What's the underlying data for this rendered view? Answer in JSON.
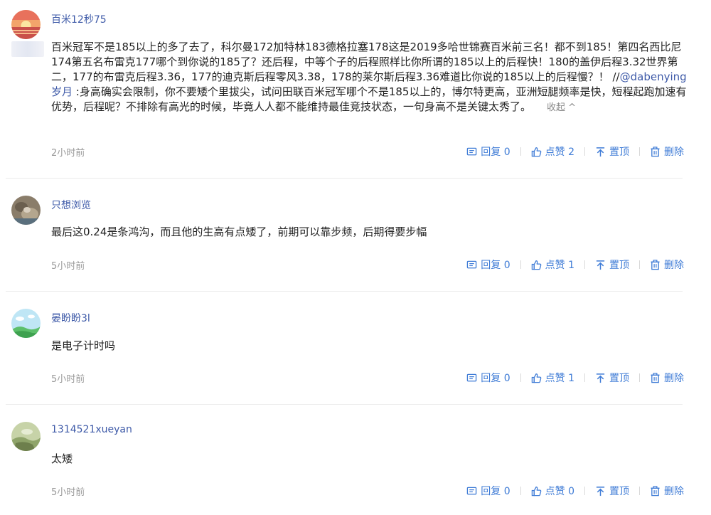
{
  "comments": [
    {
      "username": "百米12秒75",
      "text_before": "百米冠军不是185以上的多了去了，科尔曼172加特林183德格拉塞178这是2019多哈世锦赛百米前三名！都不到185！第四名西比尼174第五名布雷克177哪个到你说的185了？还后程，中等个子的后程照样比你所谓的185以上的后程快！180的盖伊后程3.32世界第二，177的布雷克后程3.36，177的迪克斯后程零风3.38，178的莱尔斯后程3.36难道比你说的185以上的后程慢？！ //",
      "mention": "@dabenying岁月",
      "text_after": " :身高确实会限制，你不要矮个里拔尖，试问田联百米冠军哪个不是185以上的，博尔特更高，亚洲短腿频率是快，短程起跑加速有优势，后程呢？不排除有高光的时候，毕竟人人都不能维持最佳竞技状态，一句身高不是关键太秀了。",
      "collapse_label": "收起 ^",
      "time": "2小时前",
      "reply_label": "回复 0",
      "like_label": "点赞 2",
      "pin_label": "置顶",
      "delete_label": "删除"
    },
    {
      "username": "只想浏览",
      "text": "最后这0.24是条鸿沟，而且他的生高有点矮了，前期可以靠步频，后期得要步幅",
      "time": "5小时前",
      "reply_label": "回复 0",
      "like_label": "点赞 1",
      "pin_label": "置顶",
      "delete_label": "删除"
    },
    {
      "username": "晏盼盼3l",
      "text": "是电子计时吗",
      "time": "5小时前",
      "reply_label": "回复 0",
      "like_label": "点赞 1",
      "pin_label": "置顶",
      "delete_label": "删除"
    },
    {
      "username": "1314521xueyan",
      "text": "太矮",
      "time": "5小时前",
      "reply_label": "回复 0",
      "like_label": "点赞 0",
      "pin_label": "置顶",
      "delete_label": "删除"
    }
  ],
  "colors": {
    "link": "#3e5aa8",
    "action": "#3e7bd6",
    "time": "#999999"
  },
  "icons": {
    "reply": "comment-icon",
    "like": "thumbs-up-icon",
    "pin": "pin-top-icon",
    "delete": "trash-icon"
  }
}
